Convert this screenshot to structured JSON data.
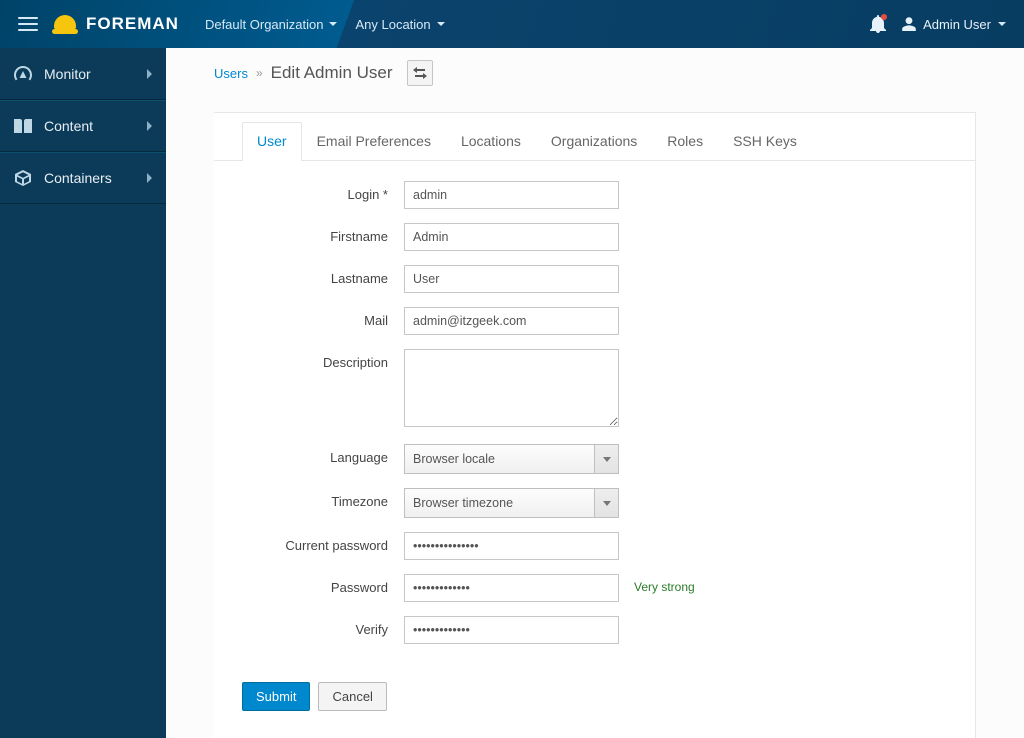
{
  "brand": "FOREMAN",
  "top_selectors": {
    "org": "Default Organization",
    "loc": "Any Location"
  },
  "top_user": "Admin User",
  "sidebar": {
    "items": [
      {
        "label": "Monitor"
      },
      {
        "label": "Content"
      },
      {
        "label": "Containers"
      }
    ]
  },
  "breadcrumb": {
    "parent": "Users",
    "title": "Edit Admin User"
  },
  "tabs": {
    "user": "User",
    "email": "Email Preferences",
    "locations": "Locations",
    "orgs": "Organizations",
    "roles": "Roles",
    "ssh": "SSH Keys"
  },
  "form": {
    "labels": {
      "login": "Login *",
      "firstname": "Firstname",
      "lastname": "Lastname",
      "mail": "Mail",
      "description": "Description",
      "language": "Language",
      "timezone": "Timezone",
      "current_password": "Current password",
      "password": "Password",
      "verify": "Verify"
    },
    "values": {
      "login": "admin",
      "firstname": "Admin",
      "lastname": "User",
      "mail": "admin@itzgeek.com",
      "description": "",
      "language": "Browser locale",
      "timezone": "Browser timezone",
      "current_password": "•••••••••••••••",
      "password": "•••••••••••••",
      "verify": "•••••••••••••"
    },
    "strength_text": "Very strong"
  },
  "buttons": {
    "submit": "Submit",
    "cancel": "Cancel"
  }
}
